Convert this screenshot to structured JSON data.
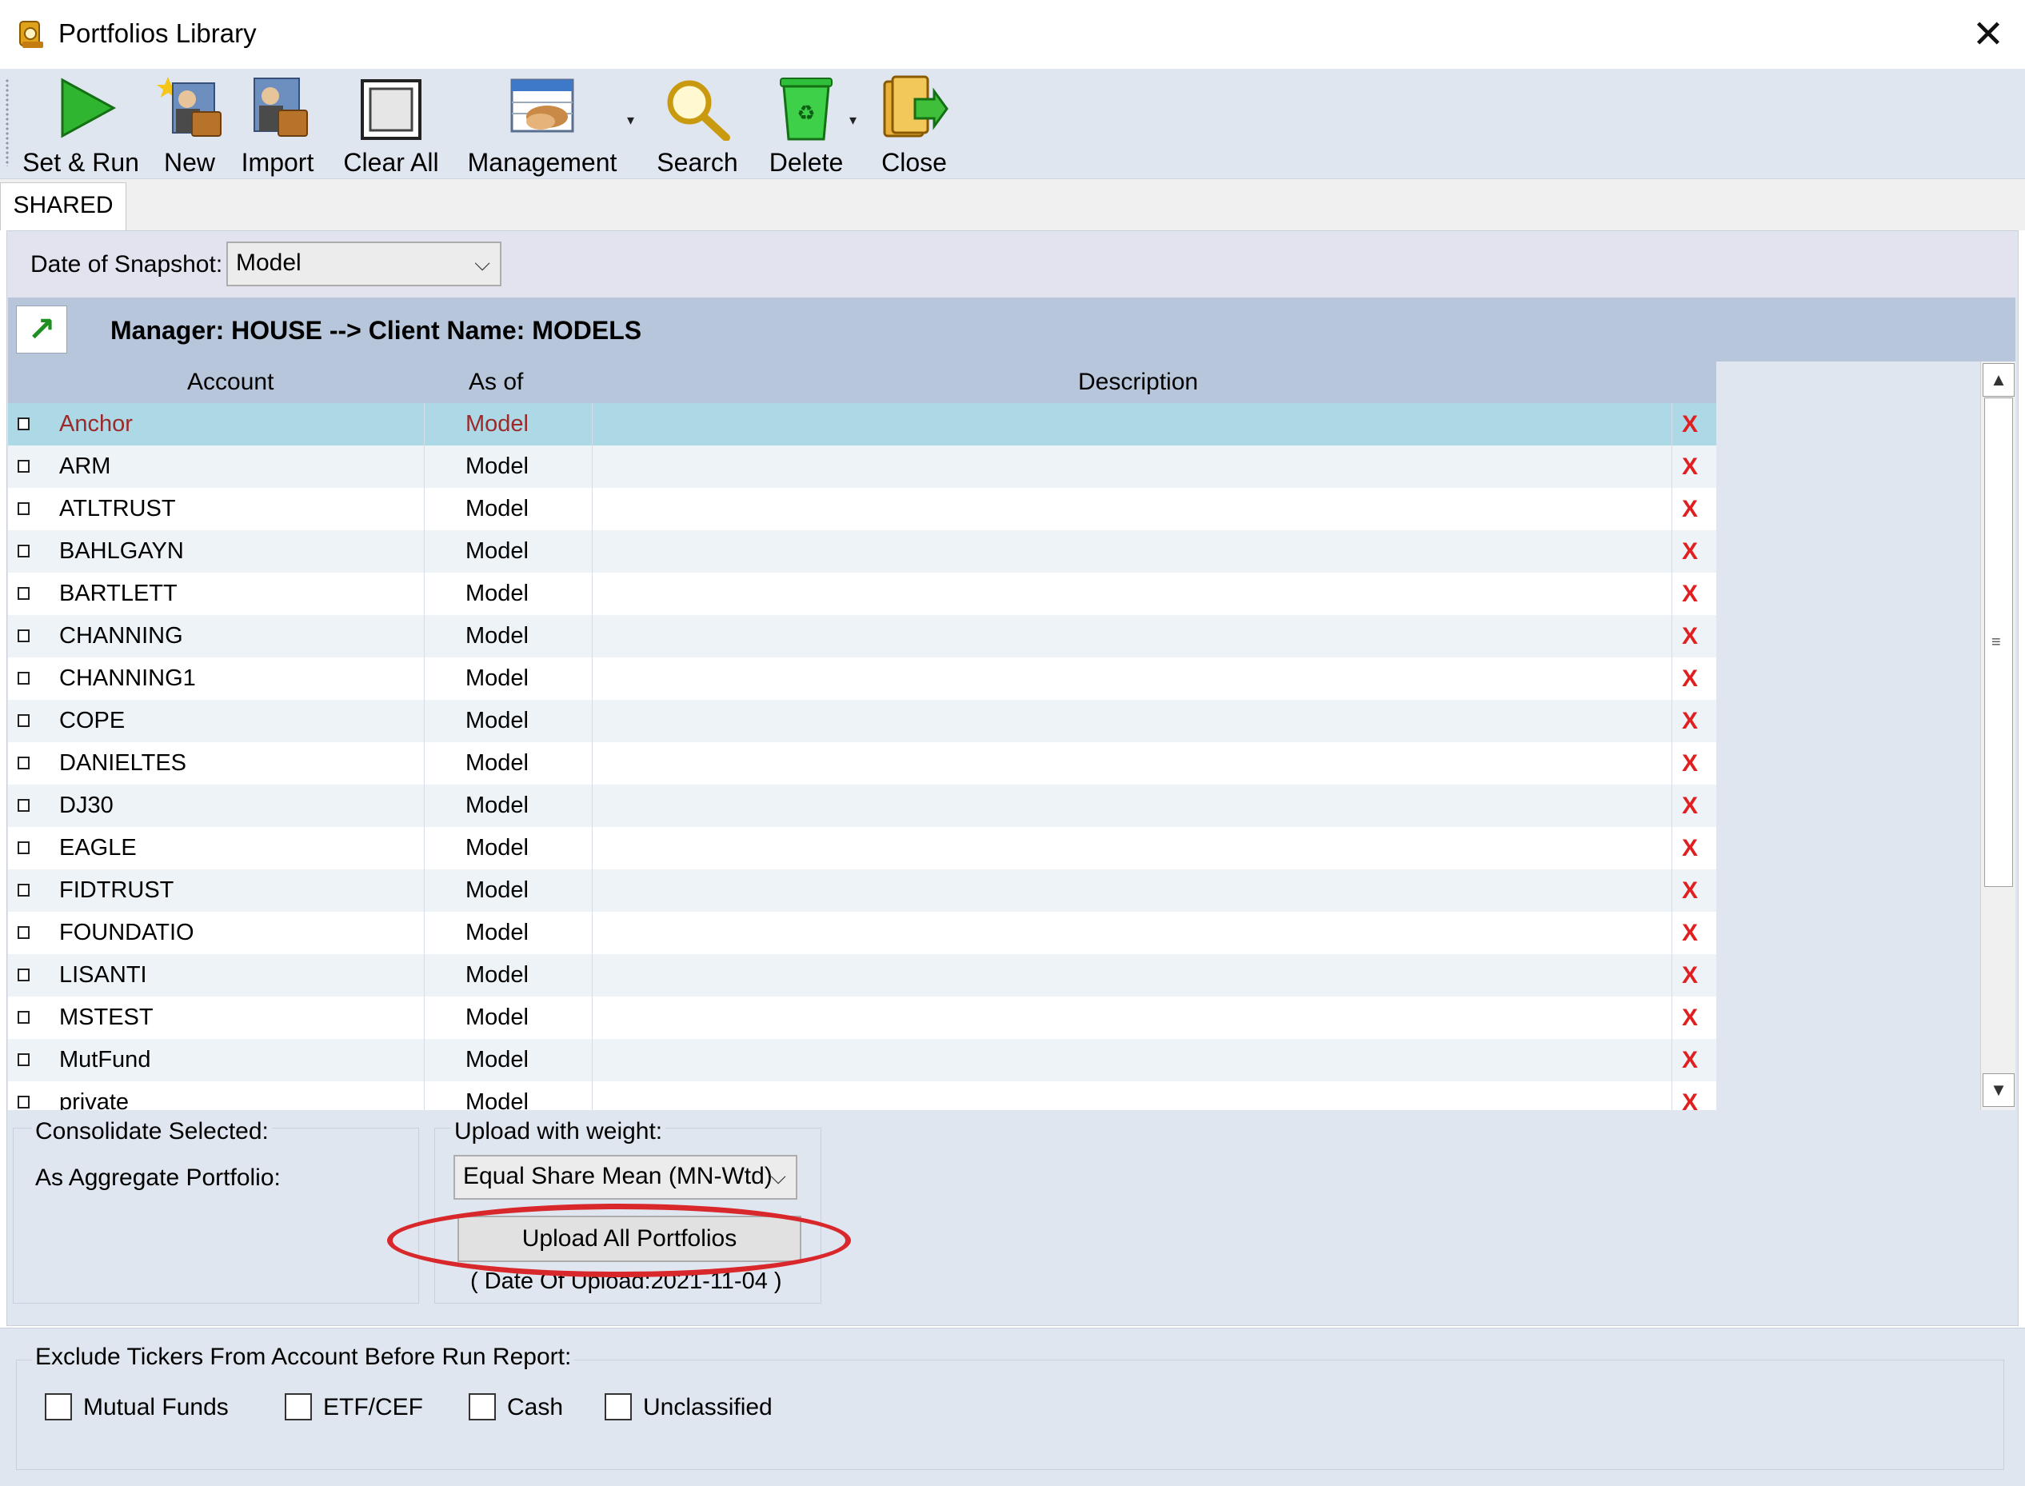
{
  "window": {
    "title": "Portfolios Library",
    "close_glyph": "✕"
  },
  "toolbar": {
    "buttons": [
      {
        "label": "Set & Run",
        "icon": "play-icon"
      },
      {
        "label": "New",
        "icon": "new-user-icon"
      },
      {
        "label": "Import",
        "icon": "import-user-icon"
      },
      {
        "label": "Clear All",
        "icon": "clear-all-icon"
      },
      {
        "label": "Management",
        "icon": "management-icon"
      },
      {
        "label": "Search",
        "icon": "magnifier-icon"
      },
      {
        "label": "Delete",
        "icon": "recycle-bin-icon"
      },
      {
        "label": "Close",
        "icon": "close-folder-icon"
      }
    ]
  },
  "tabs": [
    {
      "label": "SHARED",
      "active": true
    }
  ],
  "snapshot": {
    "label": "Date of Snapshot:",
    "value": "Model"
  },
  "breadcrumb": {
    "text": "Manager: HOUSE --> Client Name: MODELS",
    "up_glyph": "↗"
  },
  "grid": {
    "columns": {
      "account": "Account",
      "as_of": "As of",
      "description": "Description"
    },
    "delete_glyph": "X",
    "selected_index": 0,
    "rows": [
      {
        "account": "Anchor",
        "as_of": "Model",
        "description": ""
      },
      {
        "account": "ARM",
        "as_of": "Model",
        "description": ""
      },
      {
        "account": "ATLTRUST",
        "as_of": "Model",
        "description": ""
      },
      {
        "account": "BAHLGAYN",
        "as_of": "Model",
        "description": ""
      },
      {
        "account": "BARTLETT",
        "as_of": "Model",
        "description": ""
      },
      {
        "account": "CHANNING",
        "as_of": "Model",
        "description": ""
      },
      {
        "account": "CHANNING1",
        "as_of": "Model",
        "description": ""
      },
      {
        "account": "COPE",
        "as_of": "Model",
        "description": ""
      },
      {
        "account": "DANIELTES",
        "as_of": "Model",
        "description": ""
      },
      {
        "account": "DJ30",
        "as_of": "Model",
        "description": ""
      },
      {
        "account": "EAGLE",
        "as_of": "Model",
        "description": ""
      },
      {
        "account": "FIDTRUST",
        "as_of": "Model",
        "description": ""
      },
      {
        "account": "FOUNDATIO",
        "as_of": "Model",
        "description": ""
      },
      {
        "account": "LISANTI",
        "as_of": "Model",
        "description": ""
      },
      {
        "account": "MSTEST",
        "as_of": "Model",
        "description": ""
      },
      {
        "account": "MutFund",
        "as_of": "Model",
        "description": ""
      },
      {
        "account": "private",
        "as_of": "Model",
        "description": ""
      }
    ]
  },
  "consolidate": {
    "group_label": "Consolidate Selected:",
    "aggregate_label": "As Aggregate Portfolio:",
    "upload_label": "Upload with weight:",
    "weight_value": "Equal Share Mean (MN-Wtd)",
    "upload_button": "Upload All Portfolios",
    "upload_date": "( Date Of Upload:2021-11-04 )"
  },
  "exclude": {
    "label": "Exclude Tickers From Account Before Run Report:",
    "options": [
      {
        "label": "Mutual Funds",
        "checked": false
      },
      {
        "label": "ETF/CEF",
        "checked": false
      },
      {
        "label": "Cash",
        "checked": false
      },
      {
        "label": "Unclassified",
        "checked": false
      }
    ]
  },
  "colors": {
    "toolbar_bg": "#dfe6f0",
    "header_bg": "#b7c6da",
    "selected_row": "#add8e6",
    "delete_x": "#e02020",
    "highlight_ellipse": "#d9282b"
  }
}
